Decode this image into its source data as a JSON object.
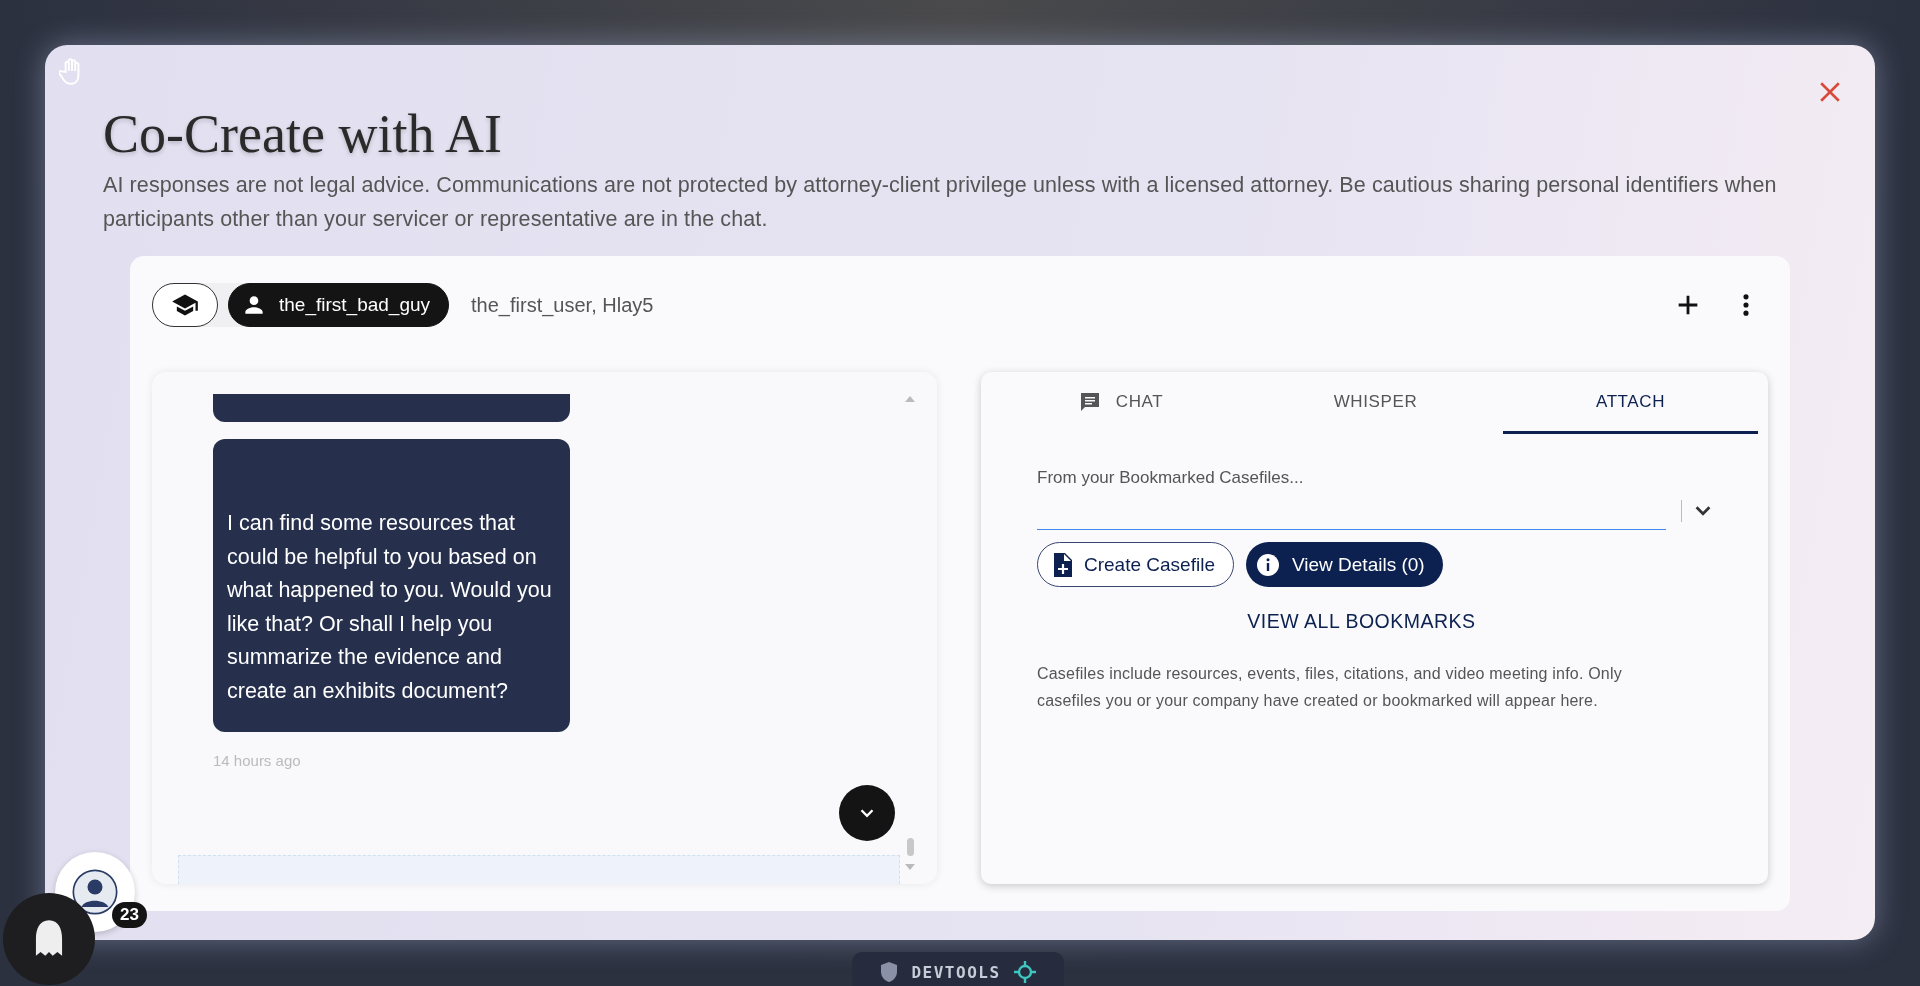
{
  "modal": {
    "title": "Co-Create with AI",
    "disclaimer": "AI responses are not legal advice. Communications are not protected by attorney-client privilege unless with a licensed attorney. Be cautious sharing personal identifiers when participants other than your servicer or representative are in the chat."
  },
  "chat_header": {
    "modes": [
      {
        "kind": "learn",
        "selected": false
      },
      {
        "kind": "user",
        "label": "the_first_bad_guy",
        "selected": true
      }
    ],
    "participants": "the_first_user, Hlay5"
  },
  "messages": [
    {
      "kind": "cut"
    },
    {
      "kind": "full",
      "text": "I can find some resources that could be helpful to you based on what happened to you. Would you like that? Or shall I help you summarize the evidence and create an exhibits document?",
      "time": "14 hours ago"
    }
  ],
  "tabs": [
    {
      "label": "CHAT",
      "icon": true,
      "selected": false
    },
    {
      "label": "WHISPER",
      "icon": false,
      "selected": false
    },
    {
      "label": "ATTACH",
      "icon": false,
      "selected": true
    }
  ],
  "attach": {
    "select_label": "From your Bookmarked Casefiles...",
    "create_button": "Create Casefile",
    "details_button": "View Details (0)",
    "view_all": "VIEW ALL BOOKMARKS",
    "note": "Casefiles include resources, events, files, citations, and video meeting info. Only casefiles you or your company have created or bookmarked will appear here."
  },
  "notifications": {
    "count": "23"
  },
  "devtools": {
    "label": "DEVTOOLS"
  }
}
